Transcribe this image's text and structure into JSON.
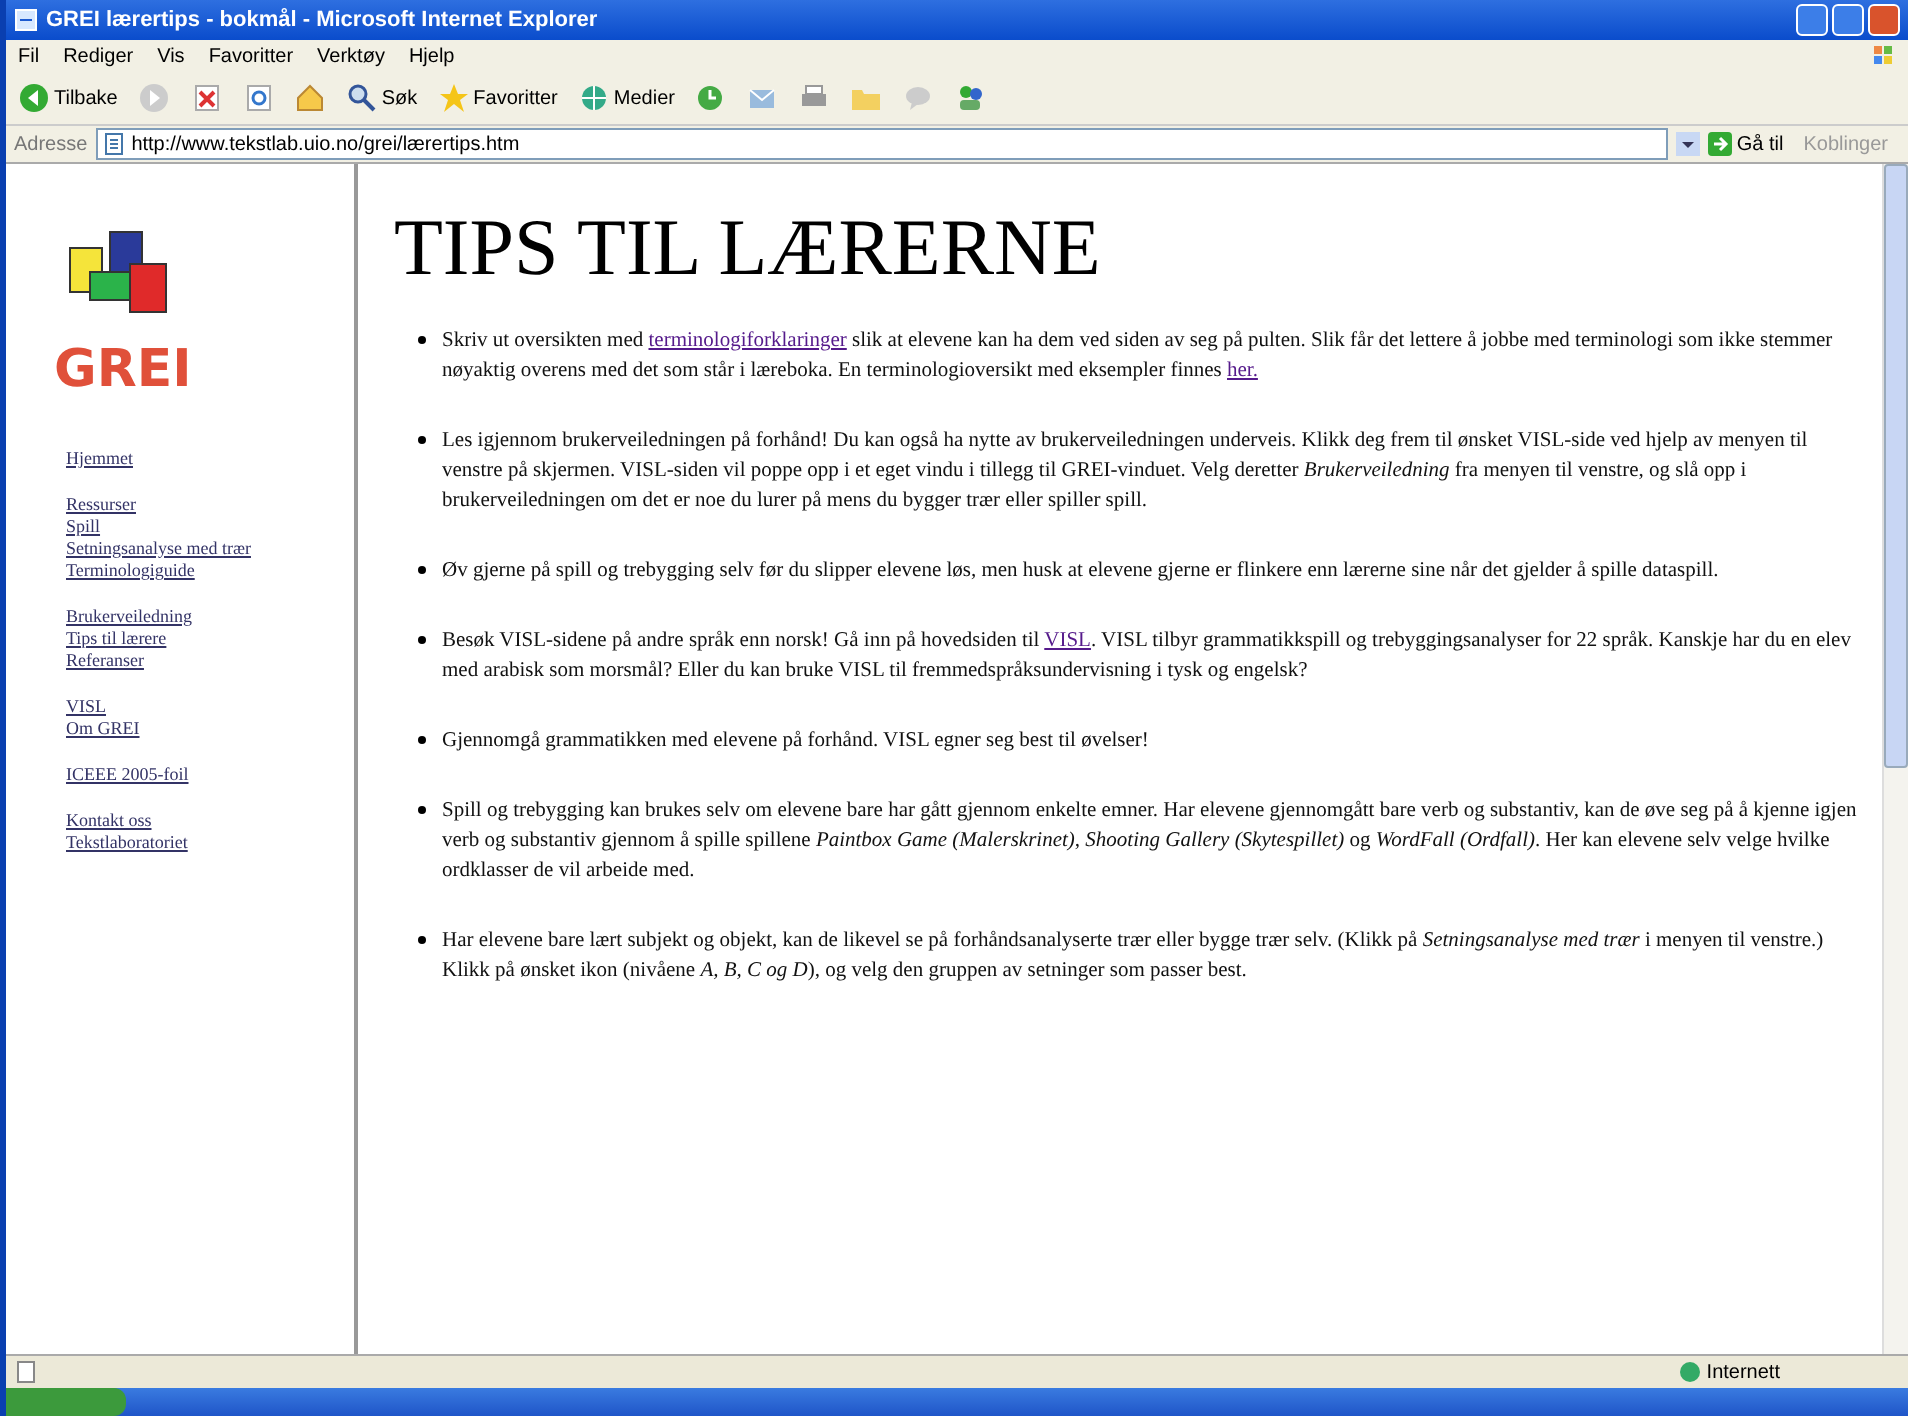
{
  "window": {
    "title": "GREI lærertips - bokmål - Microsoft Internet Explorer"
  },
  "menu": [
    "Fil",
    "Rediger",
    "Vis",
    "Favoritter",
    "Verktøy",
    "Hjelp"
  ],
  "toolbar": [
    {
      "kind": "back",
      "label": "Tilbake"
    },
    {
      "kind": "forward"
    },
    {
      "kind": "stop"
    },
    {
      "kind": "refresh"
    },
    {
      "kind": "home"
    },
    {
      "kind": "search",
      "label": "Søk"
    },
    {
      "kind": "favorites",
      "label": "Favoritter"
    },
    {
      "kind": "media",
      "label": "Medier"
    },
    {
      "kind": "history"
    },
    {
      "kind": "mail"
    },
    {
      "kind": "print"
    },
    {
      "kind": "folder"
    },
    {
      "kind": "chat"
    },
    {
      "kind": "messenger"
    }
  ],
  "address": {
    "label": "Adresse",
    "value": "http://www.tekstlab.uio.no/grei/lærertips.htm",
    "go": "Gå til",
    "links": "Koblinger"
  },
  "sidebar": {
    "logo": "GREI",
    "groups": [
      [
        "Hjemmet"
      ],
      [
        "Ressurser",
        "Spill",
        "Setningsanalyse med trær",
        "Terminologiguide"
      ],
      [
        "Brukerveiledning",
        "Tips til lærere",
        "Referanser"
      ],
      [
        "VISL",
        "Om GREI"
      ],
      [
        "ICEEE 2005-foil"
      ],
      [
        "Kontakt oss",
        "Tekstlaboratoriet"
      ]
    ]
  },
  "content": {
    "heading": "TIPS TIL LÆRERNE",
    "tips": [
      [
        {
          "kind": "text",
          "text": "Skriv ut oversikten med"
        },
        {
          "kind": "link",
          "text": "terminologiforklaringer"
        },
        {
          "kind": "text",
          "text": "slik at elevene kan ha dem ved siden av seg på pulten. Slik får det lettere å jobbe med terminologi som ikke stemmer nøyaktig overens med det som står i læreboka. En terminologioversikt med eksempler finnes"
        },
        {
          "kind": "link",
          "text": "her."
        }
      ],
      [
        {
          "kind": "text",
          "text": "Les igjennom brukerveiledningen på forhånd! Du kan også ha nytte av brukerveiledningen underveis. Klikk deg frem til ønsket VISL-side ved hjelp av menyen til venstre på skjermen. VISL-siden vil poppe opp i et eget vindu i tillegg til GREI-vinduet. Velg deretter *Brukerveiledning* fra menyen til venstre, og slå opp i brukerveiledningen om det er noe du lurer på mens du bygger trær eller spiller spill."
        }
      ],
      [
        {
          "kind": "text",
          "text": "Øv gjerne på spill og trebygging selv før du slipper elevene løs, men husk at elevene gjerne er flinkere enn lærerne sine når det gjelder å spille dataspill."
        }
      ],
      [
        {
          "kind": "text",
          "text": "Besøk VISL-sidene på andre språk enn norsk! Gå inn på hovedsiden til"
        },
        {
          "kind": "link",
          "text": "VISL"
        },
        {
          "kind": "text",
          "text": ". VISL tilbyr grammatikkspill og trebyggingsanalyser for 22 språk. Kanskje har du en elev med arabisk som morsmål? Eller du kan bruke VISL til fremmedspråksundervisning i tysk og engelsk?"
        }
      ],
      [
        {
          "kind": "text",
          "text": "Gjennomgå grammatikken med elevene på forhånd. VISL egner seg best til øvelser!"
        }
      ],
      [
        {
          "kind": "text",
          "text": "Spill og trebygging kan brukes selv om elevene bare har gått gjennom enkelte emner. Har elevene gjennomgått bare verb og substantiv, kan de øve seg på å kjenne igjen verb og substantiv gjennom å spille spillene *Paintbox Game (Malerskrinet)*, *Shooting Gallery (Skytespillet)* og *WordFall (Ordfall)*. Her kan elevene selv velge hvilke ordklasser de vil arbeide med."
        }
      ],
      [
        {
          "kind": "text",
          "text": "Har elevene bare lært subjekt og objekt, kan de likevel se på forhåndsanalyserte trær eller bygge trær selv. (Klikk på *Setningsanalyse med trær* i menyen til venstre.) Klikk på ønsket ikon (nivåene *A, B, C og D*), og velg den gruppen av setninger som passer best."
        }
      ]
    ]
  },
  "status_bar": {
    "zone": "Internett"
  }
}
